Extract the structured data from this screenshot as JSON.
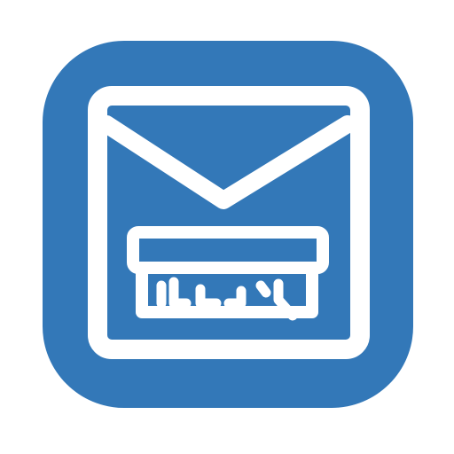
{
  "icon": {
    "name": "mail-archive-icon",
    "colors": {
      "background": "#ffffff",
      "tile": "#3378b8",
      "stroke": "#ffffff"
    }
  }
}
